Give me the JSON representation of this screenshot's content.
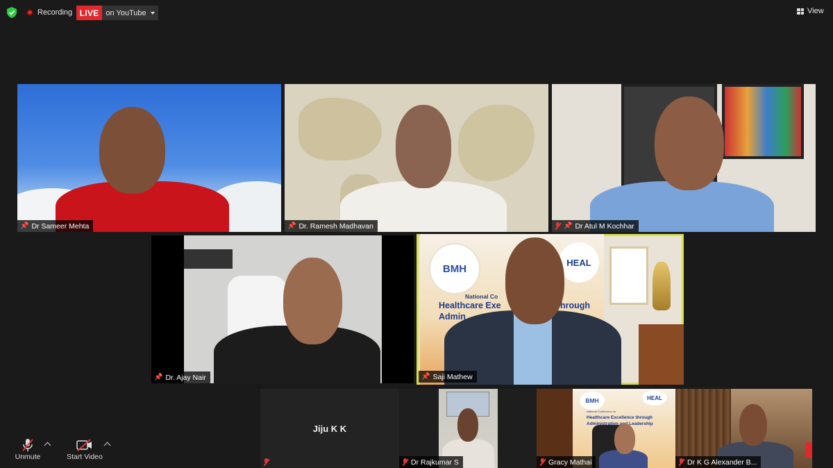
{
  "topbar": {
    "recording_label": "Recording",
    "live_label": "LIVE",
    "stream_label": "on YouTube",
    "view_label": "View",
    "colors": {
      "live": "#e0282d",
      "shield": "#2ecc40"
    }
  },
  "participants": [
    {
      "name": "Dr Sameer Mehta",
      "muted": false,
      "pinned": true
    },
    {
      "name": "Dr. Ramesh Madhavan",
      "muted": false,
      "pinned": true
    },
    {
      "name": "Dr Atul M Kochhar",
      "muted": true,
      "pinned": true
    },
    {
      "name": "Dr. Ajay Nair",
      "muted": false,
      "pinned": true
    },
    {
      "name": "Saji Mathew",
      "muted": false,
      "pinned": true,
      "active_speaker": true
    },
    {
      "name": "Jiju K K",
      "muted": true,
      "video_off": true
    },
    {
      "name": "Dr Rajkumar S",
      "muted": true
    },
    {
      "name": "Gracy Mathai",
      "muted": true
    },
    {
      "name": "Dr K G Alexander B...",
      "muted": true
    }
  ],
  "backdrop": {
    "brand": "BMH",
    "heal": "HEAL",
    "line1": "National Co",
    "line2": "Healthcare Exe",
    "line2b": "hrough",
    "line3": "Admin",
    "small_line1": "National Conference on",
    "small_line2": "Healthcare Excellence through",
    "small_line3": "Administration and Leadership"
  },
  "toolbar": {
    "unmute_label": "Unmute",
    "start_video_label": "Start Video"
  }
}
